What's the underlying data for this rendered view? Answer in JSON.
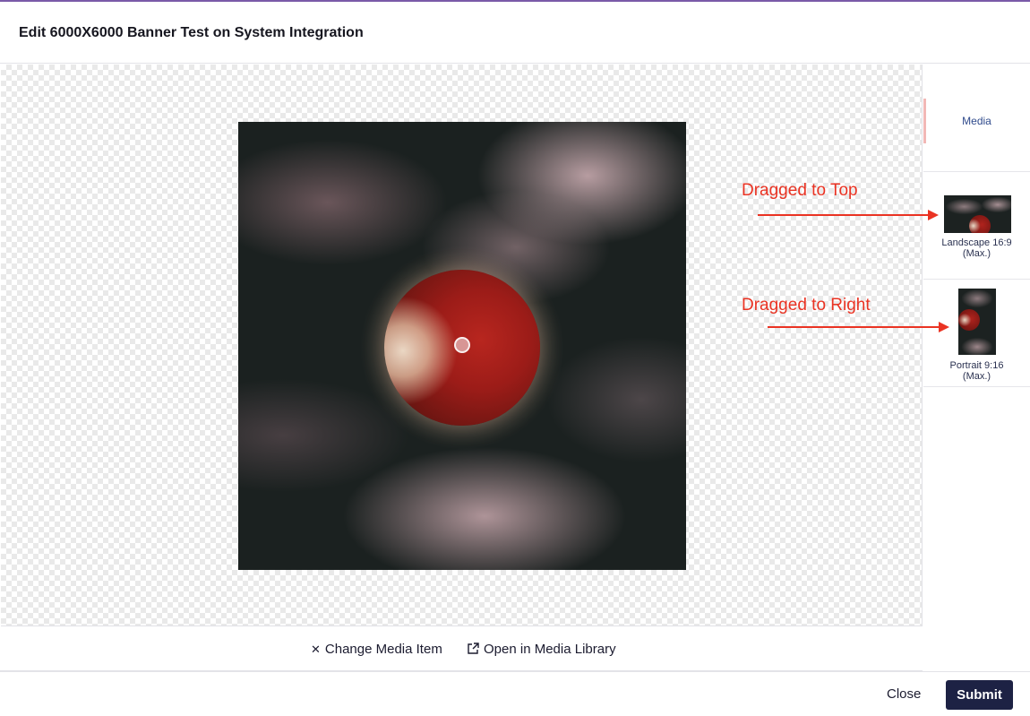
{
  "dialog": {
    "title": "Edit 6000X6000 Banner Test on System Integration"
  },
  "editor": {
    "image_icon": "moon-image"
  },
  "sidebar": {
    "media_tab_label": "Media",
    "crops": [
      {
        "label": "Landscape 16:9",
        "sublabel": "(Max.)"
      },
      {
        "label": "Portrait 9:16",
        "sublabel": "(Max.)"
      }
    ]
  },
  "annotations": {
    "top": "Dragged to Top",
    "right": "Dragged to Right",
    "color": "#ea3323"
  },
  "actions": {
    "change_media": "Change Media Item",
    "open_library": "Open in Media Library"
  },
  "footer": {
    "close_label": "Close",
    "submit_label": "Submit",
    "submit_color": "#1d2244"
  }
}
